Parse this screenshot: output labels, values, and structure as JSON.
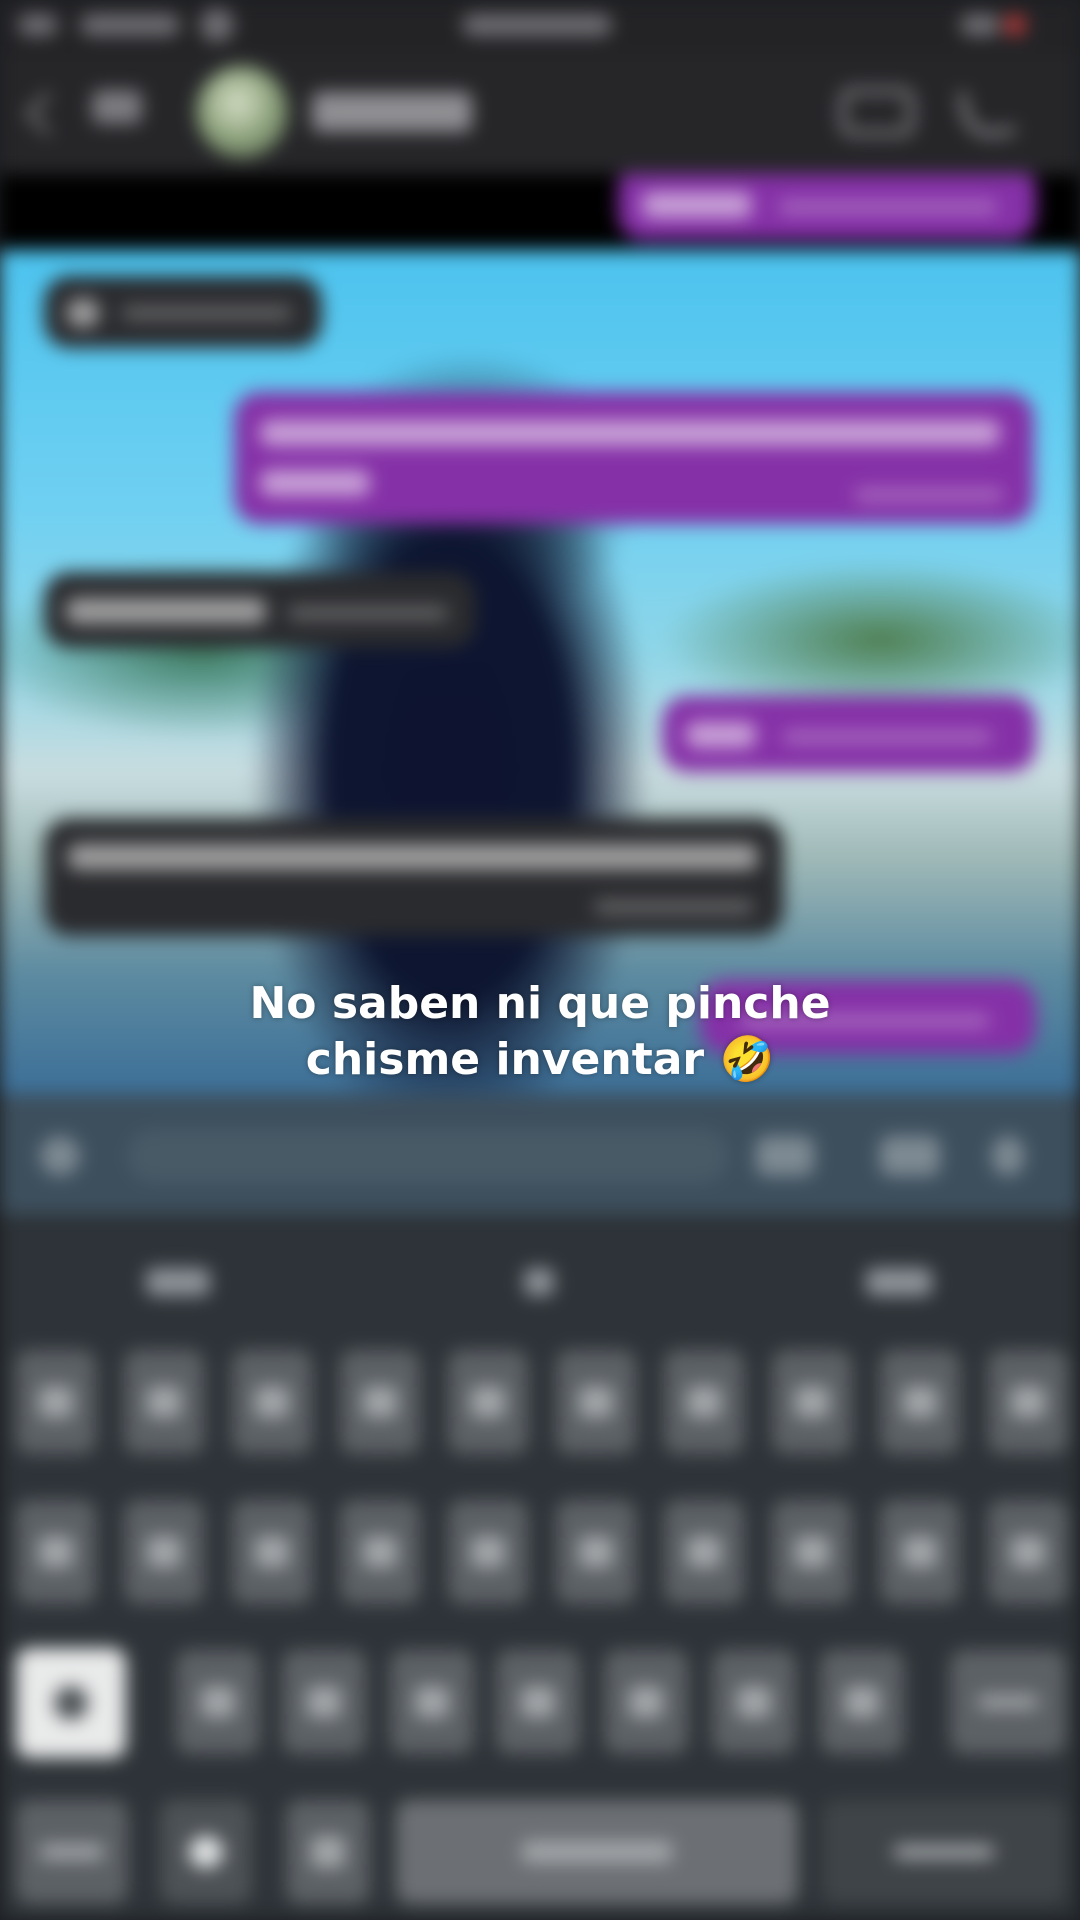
{
  "caption": {
    "line1": "No saben ni que pinche",
    "line2": "chisme inventar 🤣"
  },
  "colors": {
    "outgoing_bubble": "#8530a7",
    "incoming_bubble": "#2a2b2e",
    "caption_text": "#ffffff",
    "keyboard_bg": "#2d3338"
  },
  "icons": [
    "back-arrow-icon",
    "video-call-icon",
    "phone-icon",
    "emoji-icon",
    "camera-icon",
    "gallery-icon",
    "mic-icon",
    "shift-icon"
  ]
}
